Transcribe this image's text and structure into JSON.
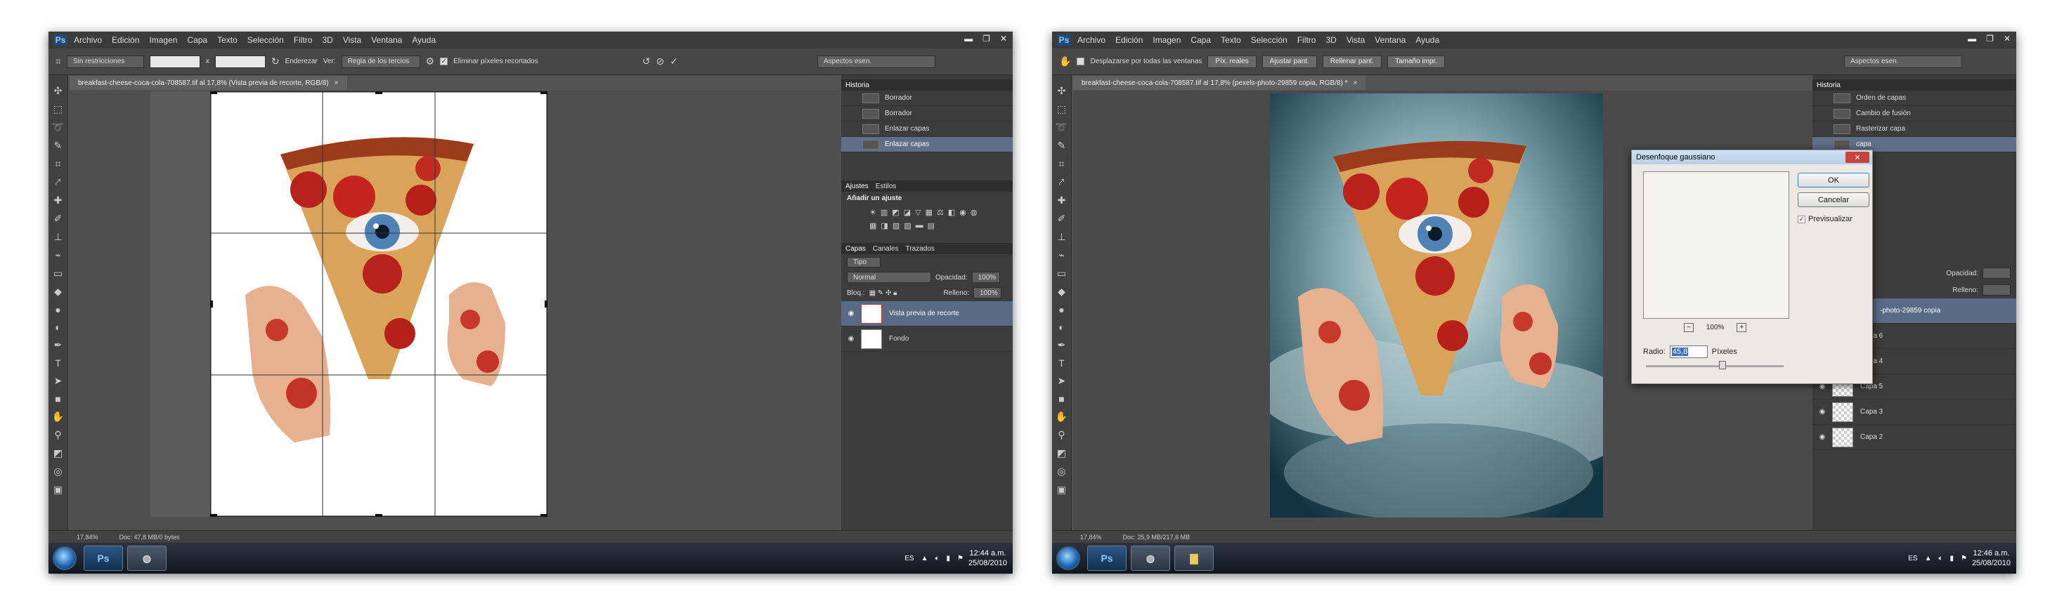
{
  "app": {
    "logo": "Ps",
    "menu": [
      "Archivo",
      "Edición",
      "Imagen",
      "Capa",
      "Texto",
      "Selección",
      "Filtro",
      "3D",
      "Vista",
      "Ventana",
      "Ayuda"
    ]
  },
  "s1": {
    "options": {
      "preset": "Sin restricciones",
      "x_sep": "x",
      "straighten": "Enderezar",
      "view_label": "Ver:",
      "view_value": "Regla de los tercios",
      "delete_pixels": "Eliminar píxeles recortados",
      "workspace": "Aspectos esen."
    },
    "tab": "breakfast-cheese-coca-cola-708587.tif al 17,8% (Vista previa de recorte, RGB/8)",
    "history": {
      "title": "Historia",
      "items": [
        "Borrador",
        "Borrador",
        "Enlazar capas",
        "Enlazar capas"
      ]
    },
    "adjust": {
      "tabs": [
        "Ajustes",
        "Estilos"
      ],
      "heading": "Añadir un ajuste"
    },
    "layers": {
      "tabs": [
        "Capas",
        "Canales",
        "Trazados"
      ],
      "kind": "Tipo",
      "blend": "Normal",
      "opacity_label": "Opacidad:",
      "opacity": "100%",
      "lock_label": "Bloq.:",
      "fill_label": "Relleno:",
      "fill": "100%",
      "items": [
        "Vista previa de recorte",
        "Fondo"
      ]
    },
    "status": {
      "zoom": "17,84%",
      "doc": "Doc: 47,8 MB/0 bytes"
    },
    "clock": {
      "time": "12:44 a.m.",
      "date": "25/08/2010"
    }
  },
  "s2": {
    "options": {
      "scroll_all": "Desplazarse por todas las ventanas",
      "b1": "Píx. reales",
      "b2": "Ajustar pant.",
      "b3": "Rellenar pant.",
      "b4": "Tamaño impr.",
      "workspace": "Aspectos esen."
    },
    "tab": "breakfast-cheese-coca-cola-708587.tif al 17,8% (pexels-photo-29859 copia, RGB/8) *",
    "history": {
      "title": "Historia",
      "items": [
        "Orden de capas",
        "Cambio de fusión",
        "Rasterizar capa",
        "capa"
      ]
    },
    "layers": {
      "opacity_label": "Opacidad:",
      "fill_label": "Relleno:",
      "active": "-photo-29859 copia",
      "items": [
        "Capa 6",
        "Capa 4",
        "Capa 5",
        "Capa 3",
        "Capa 2"
      ]
    },
    "dialog": {
      "title": "Desenfoque gaussiano",
      "ok": "OK",
      "cancel": "Cancelar",
      "preview": "Previsualizar",
      "zoom": "100%",
      "radius_label": "Radio:",
      "radius": "45,8",
      "unit": "Píxeles"
    },
    "status": {
      "zoom": "17,84%",
      "doc": "Doc: 25,9 MB/217,6 MB"
    },
    "clock": {
      "time": "12:46 a.m.",
      "date": "25/08/2010"
    }
  },
  "taskbar": {
    "lang": "ES"
  }
}
